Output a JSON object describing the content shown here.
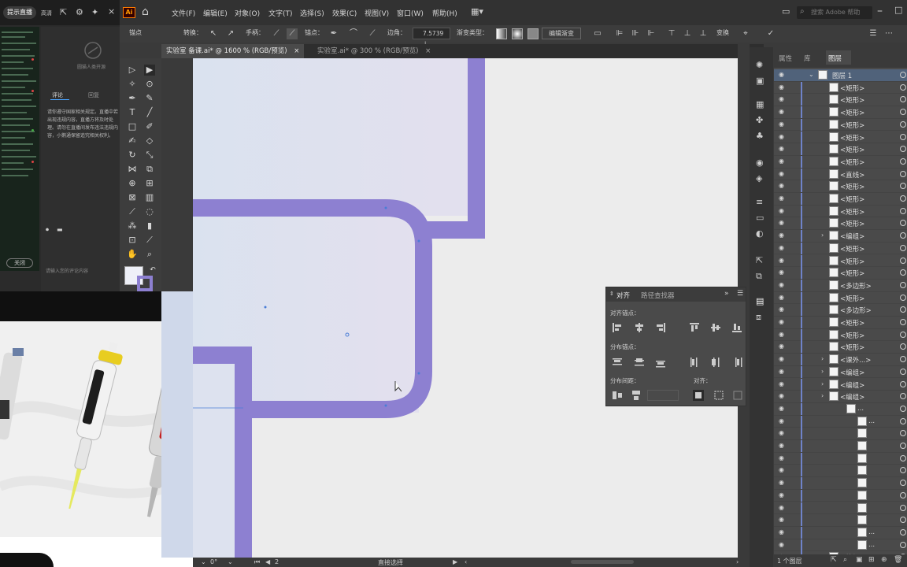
{
  "live_panel": {
    "top_button": "提示直播",
    "top_label": "高清",
    "avatar_caption": "圆猫人类开源",
    "tabs": [
      "评论",
      "回复"
    ],
    "notice": "请你遵守国家相关规定。直播中若出现违规内容，直播方将及时处理。请勿在直播间发布违法违规内容，小鹅通保留追究相关权利。",
    "connect_button": "关闭",
    "input_placeholder": "请输入您的评论内容"
  },
  "menubar": {
    "app_badge": "Ai",
    "items": [
      "文件(F)",
      "编辑(E)",
      "对象(O)",
      "文字(T)",
      "选择(S)",
      "效果(C)",
      "视图(V)",
      "窗口(W)",
      "帮助(H)"
    ],
    "search_placeholder": "搜索 Adobe 帮助"
  },
  "controlbar": {
    "anchor_label": "锚点",
    "convert_label": "转换：",
    "handle_label": "手柄：",
    "anchor2_label": "锚点：",
    "corner_label": "边角：",
    "corner_value": "7.5739 ↓",
    "gradient_label": "渐变类型：",
    "edit_gradient_button": "编辑渐变",
    "transform_label": "变换"
  },
  "tabs": [
    {
      "label": "实验室 备课.ai* @ 1600 % (RGB/预览)",
      "close": "×",
      "active": true
    },
    {
      "label": "实验室.ai* @ 300 % (RGB/预览)",
      "close": "×",
      "active": false
    }
  ],
  "align_panel": {
    "tab_align": "对齐",
    "tab_pathfinder": "路径查找器",
    "section_align_objects": "对齐锚点：",
    "section_distribute_objects": "分布锚点：",
    "section_distribute_spacing": "分布间距：",
    "section_align_to": "对齐："
  },
  "layers_panel": {
    "tabs": [
      "属性",
      "库",
      "图层"
    ],
    "active_tab": "图层",
    "layer_name": "图层 1",
    "rows": [
      "<矩形>",
      "<矩形>",
      "<矩形>",
      "<矩形>",
      "<矩形>",
      "<矩形>",
      "<矩形>",
      "<直线>",
      "<矩形>",
      "<矩形>",
      "<矩形>",
      "<矩形>",
      "<编组>",
      "<矩形>",
      "<矩形>",
      "<矩形>",
      "<多边形>",
      "<矩形>",
      "<多边形>",
      "<矩形>",
      "<矩形>",
      "<矩形>",
      "<课外...>",
      "<编组>",
      "<编组>",
      "<编组>",
      "...",
      "...",
      "",
      "",
      "",
      "",
      "",
      "",
      "",
      "",
      "...",
      "...",
      "<编组>"
    ],
    "status": "1 个图层"
  },
  "statusbar": {
    "zoom": "0°",
    "artboard": "2",
    "tool": "直接选择"
  },
  "colors": {
    "accent": "#8d80d1",
    "fill_light": "#dde2ef",
    "canvas": "#ececec"
  }
}
